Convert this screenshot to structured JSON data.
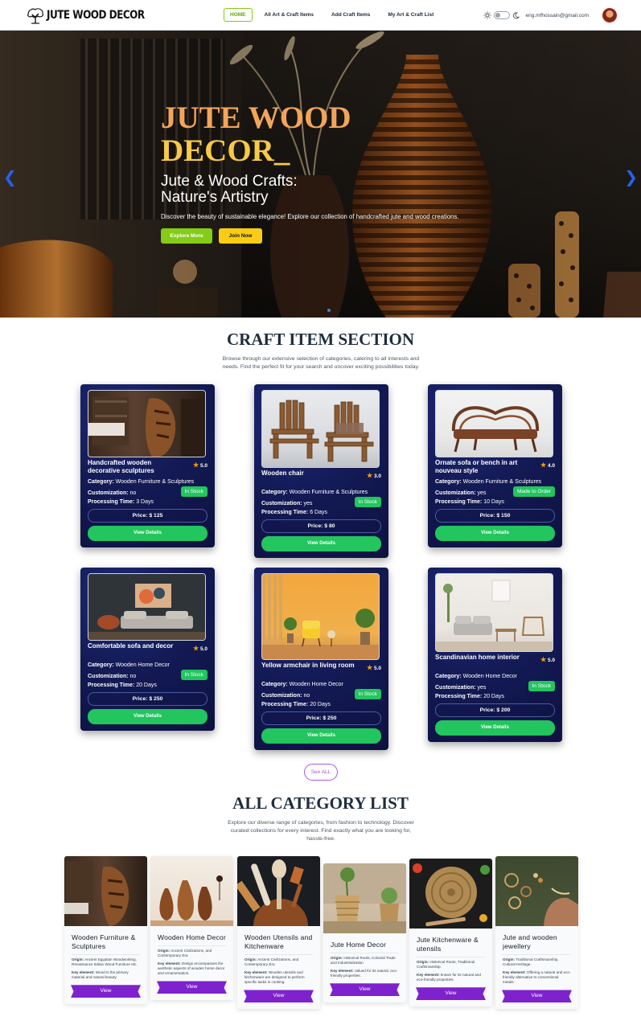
{
  "nav": {
    "logo_text": "JUTE WOOD DECOR",
    "links": [
      "HOME",
      "All Art & Craft Items",
      "Add Craft Items",
      "My Art & Craft List"
    ],
    "active_link": "HOME",
    "email": "eng.mfhossain@gmail.com",
    "icons": [
      "sun-icon",
      "theme-toggle",
      "moon-icon",
      "user-avatar"
    ]
  },
  "hero": {
    "title_line1": "JUTE WOOD",
    "title_line2": "DECOR_",
    "subtitle_line1": "Jute & Wood Crafts:",
    "subtitle_line2": "Nature's Artistry",
    "description": "Discover the beauty of sustainable elegance! Explore our collection of handcrafted jute and wood creations.",
    "explore_button": "Explore More",
    "join_button": "Join Now",
    "prev_icon": "chevron-left-icon",
    "next_icon": "chevron-right-icon",
    "colors": {
      "title_orange": "#f2a55a",
      "title_yellow": "#f7c948",
      "explore": "#84cc16",
      "join": "#facc15"
    }
  },
  "craft_section": {
    "title": "CRAFT ITEM SECTION",
    "description": "Browse through our extensive selection of categories, catering to all interests and needs. Find the perfect fit for your search and uncover exciting possibilities today.",
    "labels": {
      "category": "Category:",
      "customization": "Customization:",
      "processing": "Processing Time:",
      "price_prefix": "Price: $ ",
      "view_details": "View Details"
    },
    "items": [
      {
        "name": "Handcrafted wooden decorative sculptures",
        "rating": "5.0",
        "category": "Wooden Furniture & Sculptures",
        "customization": "no",
        "stock": "In Stock",
        "processing": "3 Days",
        "price": "125"
      },
      {
        "name": "Wooden chair",
        "rating": "3.0",
        "category": "Wooden Furniture & Sculptures",
        "customization": "yes",
        "stock": "In Stock",
        "processing": "6 Days",
        "price": "80"
      },
      {
        "name": "Ornate sofa or bench in art nouveau style",
        "rating": "4.0",
        "category": "Wooden Furniture & Sculptures",
        "customization": "yes",
        "stock": "Made to Order",
        "processing": "10 Days",
        "price": "150"
      },
      {
        "name": "Comfortable sofa and decor",
        "rating": "5.0",
        "category": "Wooden Home Decor",
        "customization": "no",
        "stock": "In Stock",
        "processing": "20 Days",
        "price": "250"
      },
      {
        "name": "Yellow armchair in living room",
        "rating": "5.0",
        "category": "Wooden Home Decor",
        "customization": "no",
        "stock": "In Stock",
        "processing": "20 Days",
        "price": "250"
      },
      {
        "name": "Scandinavian home interior",
        "rating": "5.0",
        "category": "Wooden Home Decor",
        "customization": "yes",
        "stock": "In Stock",
        "processing": "20 Days",
        "price": "200"
      }
    ],
    "see_all": "See ALL"
  },
  "category_section": {
    "title": "ALL CATEGORY LIST",
    "description": "Explore our diverse range of categories, from fashion to technology. Discover curated collections for every interest. Find exactly what you are looking for, hassle-free.",
    "labels": {
      "origin": "Origin:",
      "key": "Key element:",
      "view": "View"
    },
    "items": [
      {
        "title": "Wooden Furniture & Sculptures",
        "origin": "Ancient Egyptian Woodworking, Renaissance Italian Wood Furniture etc.",
        "key": "Wood is the primary material and natural beauty."
      },
      {
        "title": "Wooden Home Decor",
        "origin": "Ancient Civilizations, and Contemporary Era",
        "key": "Design encompasses the aesthetic aspects of wooden home decor and ornamentation."
      },
      {
        "title": "Wooden Utensils and Kitchenware",
        "origin": "Ancient Civilizations, and Contemporary Era",
        "key": "Wooden utensils and kitchenware are designed to perform specific tasks in cooking."
      },
      {
        "title": "Jute Home Decor",
        "origin": "Historical Roots, Colonial Trade and Industrialization",
        "key": "Valued for its natural, eco-friendly properties."
      },
      {
        "title": "Jute Kitchenware & utensils",
        "origin": "Historical Roots, Traditional Craftsmanship.",
        "key": "known for its natural and eco-friendly properties."
      },
      {
        "title": "Jute and wooden jewellery",
        "origin": "Traditional Craftsmanship, Cultural Heritage.",
        "key": "Offering a natural and eco-friendly alternative to conventional metals."
      }
    ]
  }
}
